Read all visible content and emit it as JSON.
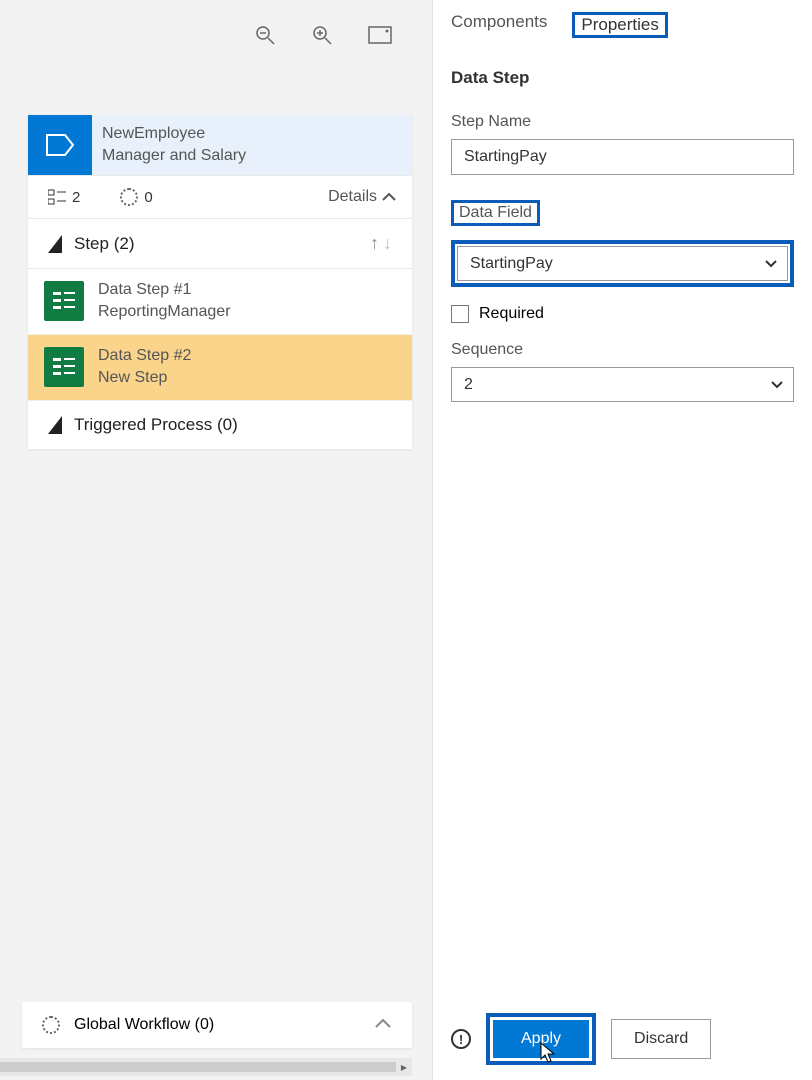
{
  "toolbar": {},
  "card": {
    "header": {
      "line1": "NewEmployee",
      "line2": "Manager and Salary"
    },
    "meta": {
      "steps_count": "2",
      "circle_count": "0"
    },
    "details_label": "Details",
    "step_label": "Step",
    "step_count": "(2)",
    "items": [
      {
        "title": "Data Step #1",
        "subtitle": "ReportingManager"
      },
      {
        "title": "Data Step #2",
        "subtitle": "New Step"
      }
    ],
    "triggered_label": "Triggered Process (0)"
  },
  "bottom": {
    "label": "Global Workflow (0)"
  },
  "tabs": {
    "components": "Components",
    "properties": "Properties"
  },
  "form": {
    "section": "Data Step",
    "step_name_label": "Step Name",
    "step_name_value": "StartingPay",
    "data_field_label": "Data Field",
    "data_field_value": "StartingPay",
    "required_label": "Required",
    "sequence_label": "Sequence",
    "sequence_value": "2"
  },
  "footer": {
    "apply": "Apply",
    "discard": "Discard"
  }
}
